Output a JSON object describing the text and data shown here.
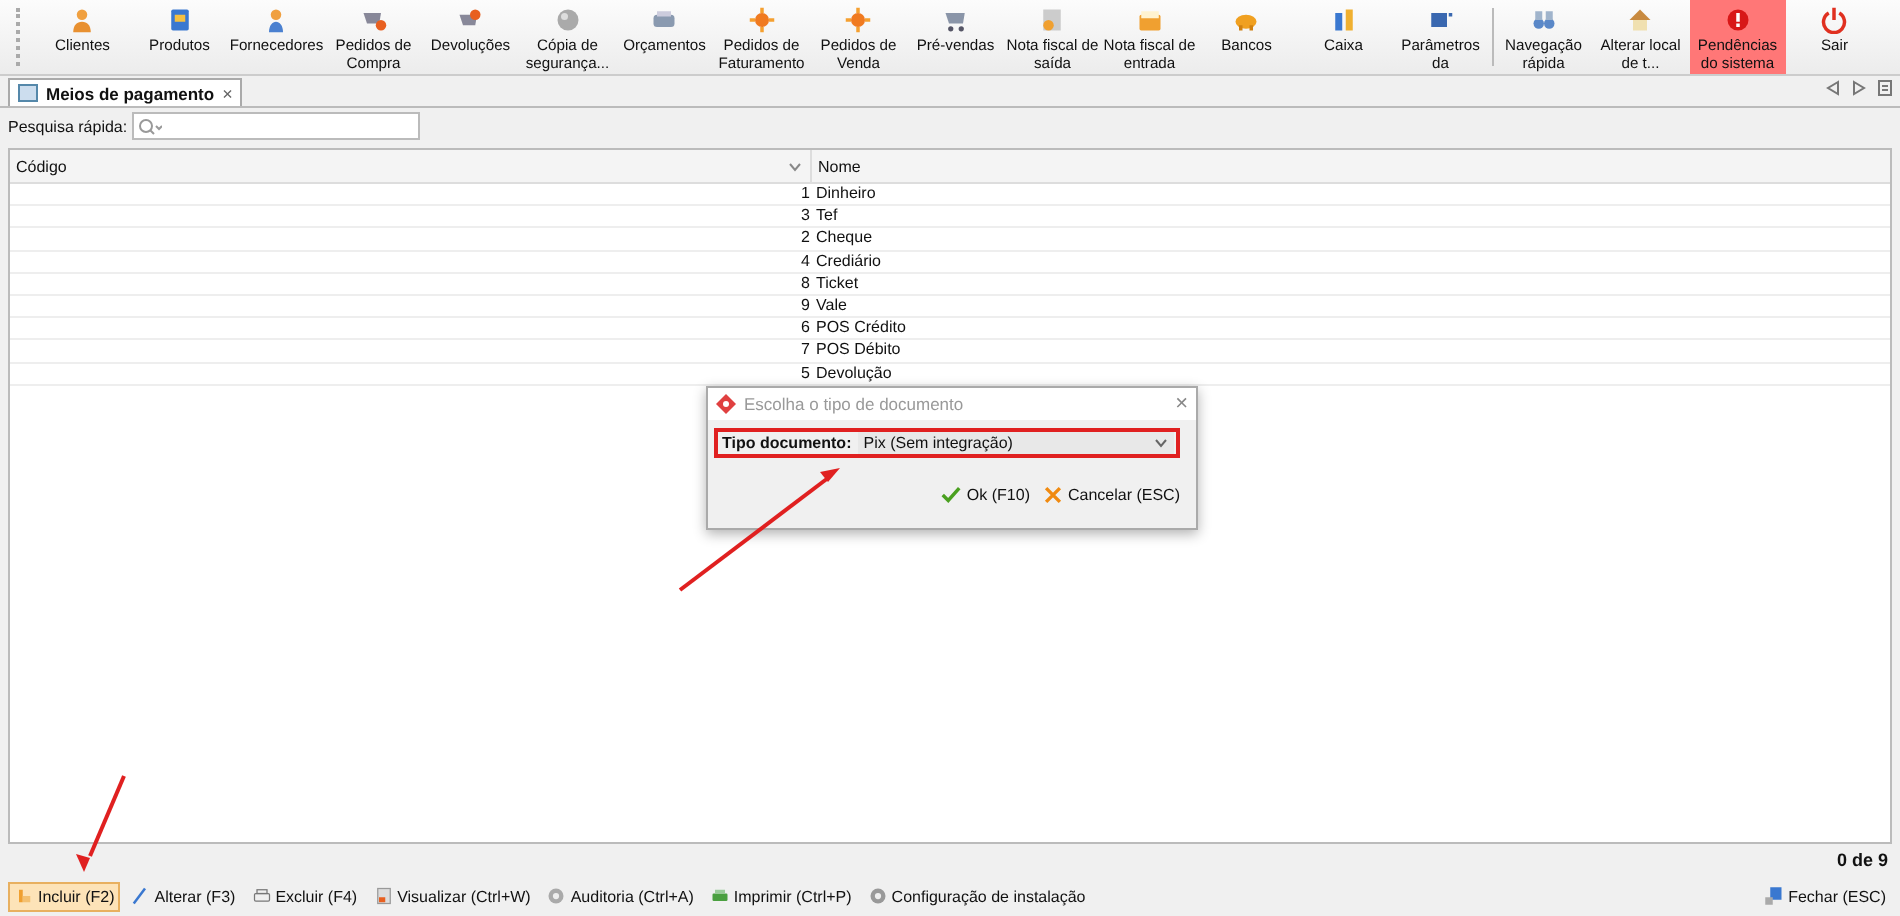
{
  "toolbar": [
    {
      "label": "Clientes",
      "selected": false
    },
    {
      "label": "Produtos",
      "selected": false
    },
    {
      "label": "Fornecedores",
      "selected": false
    },
    {
      "label": "Pedidos de Compra",
      "selected": false
    },
    {
      "label": "Devoluções",
      "selected": false
    },
    {
      "label": "Cópia de segurança...",
      "selected": false
    },
    {
      "label": "Orçamentos",
      "selected": false
    },
    {
      "label": "Pedidos de Faturamento",
      "selected": false
    },
    {
      "label": "Pedidos de Venda",
      "selected": false
    },
    {
      "label": "Pré-vendas",
      "selected": false
    },
    {
      "label": "Nota fiscal de saída",
      "selected": false
    },
    {
      "label": "Nota fiscal de entrada",
      "selected": false
    },
    {
      "label": "Bancos",
      "selected": false
    },
    {
      "label": "Caixa",
      "selected": false
    },
    {
      "label": "Parâmetros da",
      "selected": false
    },
    {
      "label": "Navegação rápida",
      "selected": false
    },
    {
      "label": "Alterar local de t...",
      "selected": false
    },
    {
      "label": "Pendências do sistema",
      "selected": true
    },
    {
      "label": "Sair",
      "selected": false
    }
  ],
  "tabs": [
    {
      "label": "Meios de pagamento",
      "selected": true,
      "close": "×"
    }
  ],
  "search": {
    "label": "Pesquisa rápida:"
  },
  "table": {
    "columns": [
      "Código",
      "Nome"
    ],
    "rows": [
      {
        "code": "1",
        "name": "Dinheiro"
      },
      {
        "code": "3",
        "name": "Tef"
      },
      {
        "code": "2",
        "name": "Cheque"
      },
      {
        "code": "4",
        "name": "Crediário"
      },
      {
        "code": "8",
        "name": "Ticket"
      },
      {
        "code": "9",
        "name": "Vale"
      },
      {
        "code": "6",
        "name": "POS Crédito"
      },
      {
        "code": "7",
        "name": "POS Débito"
      },
      {
        "code": "5",
        "name": "Devolução"
      }
    ]
  },
  "dialog": {
    "title": "Escolha o tipo de documento",
    "close": "×",
    "field_label": "Tipo documento:",
    "field_value": "Pix (Sem integração)",
    "buttons": [
      {
        "kind": "ok",
        "label": "Ok (F10)"
      },
      {
        "kind": "cancel",
        "label": "Cancelar (ESC)"
      }
    ]
  },
  "record_count": "0 de 9",
  "actions": [
    {
      "kind": "add",
      "label": "Incluir (F2)",
      "selected": true
    },
    {
      "kind": "edit",
      "label": "Alterar (F3)",
      "selected": false
    },
    {
      "kind": "delete",
      "label": "Excluir (F4)",
      "selected": false
    },
    {
      "kind": "view",
      "label": "Visualizar (Ctrl+W)",
      "selected": false
    },
    {
      "kind": "audit",
      "label": "Auditoria (Ctrl+A)",
      "selected": false
    },
    {
      "kind": "print",
      "label": "Imprimir (Ctrl+P)",
      "selected": false
    },
    {
      "kind": "config",
      "label": "Configuração de instalação",
      "selected": false
    }
  ],
  "close_button": "Fechar (ESC)"
}
